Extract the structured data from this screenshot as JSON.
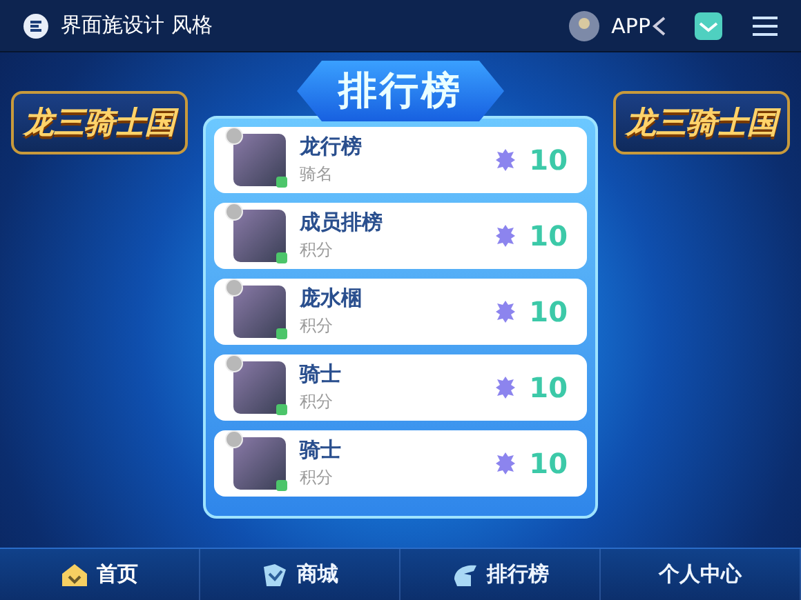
{
  "top_bar": {
    "brand": "界面旄设计 风格",
    "app_label": "APP"
  },
  "logos": [
    "龙三骑士国",
    "龙三骑士国"
  ],
  "ranking": {
    "title": "排行榜",
    "rows": [
      {
        "name": "龙行榜",
        "subtitle": "骑名",
        "score": "10"
      },
      {
        "name": "成员排榜",
        "subtitle": "积分",
        "score": "10"
      },
      {
        "name": "庞水棞",
        "subtitle": "积分",
        "score": "10"
      },
      {
        "name": "骑士",
        "subtitle": "积分",
        "score": "10"
      },
      {
        "name": "骑士",
        "subtitle": "积分",
        "score": "10"
      }
    ]
  },
  "bottom_nav": [
    {
      "label": "首页",
      "kind": "home",
      "selected": true
    },
    {
      "label": "商城",
      "kind": "shop",
      "selected": false
    },
    {
      "label": "排行榜",
      "kind": "rank",
      "selected": false
    },
    {
      "label": "个人中心",
      "kind": "none",
      "selected": false
    }
  ]
}
